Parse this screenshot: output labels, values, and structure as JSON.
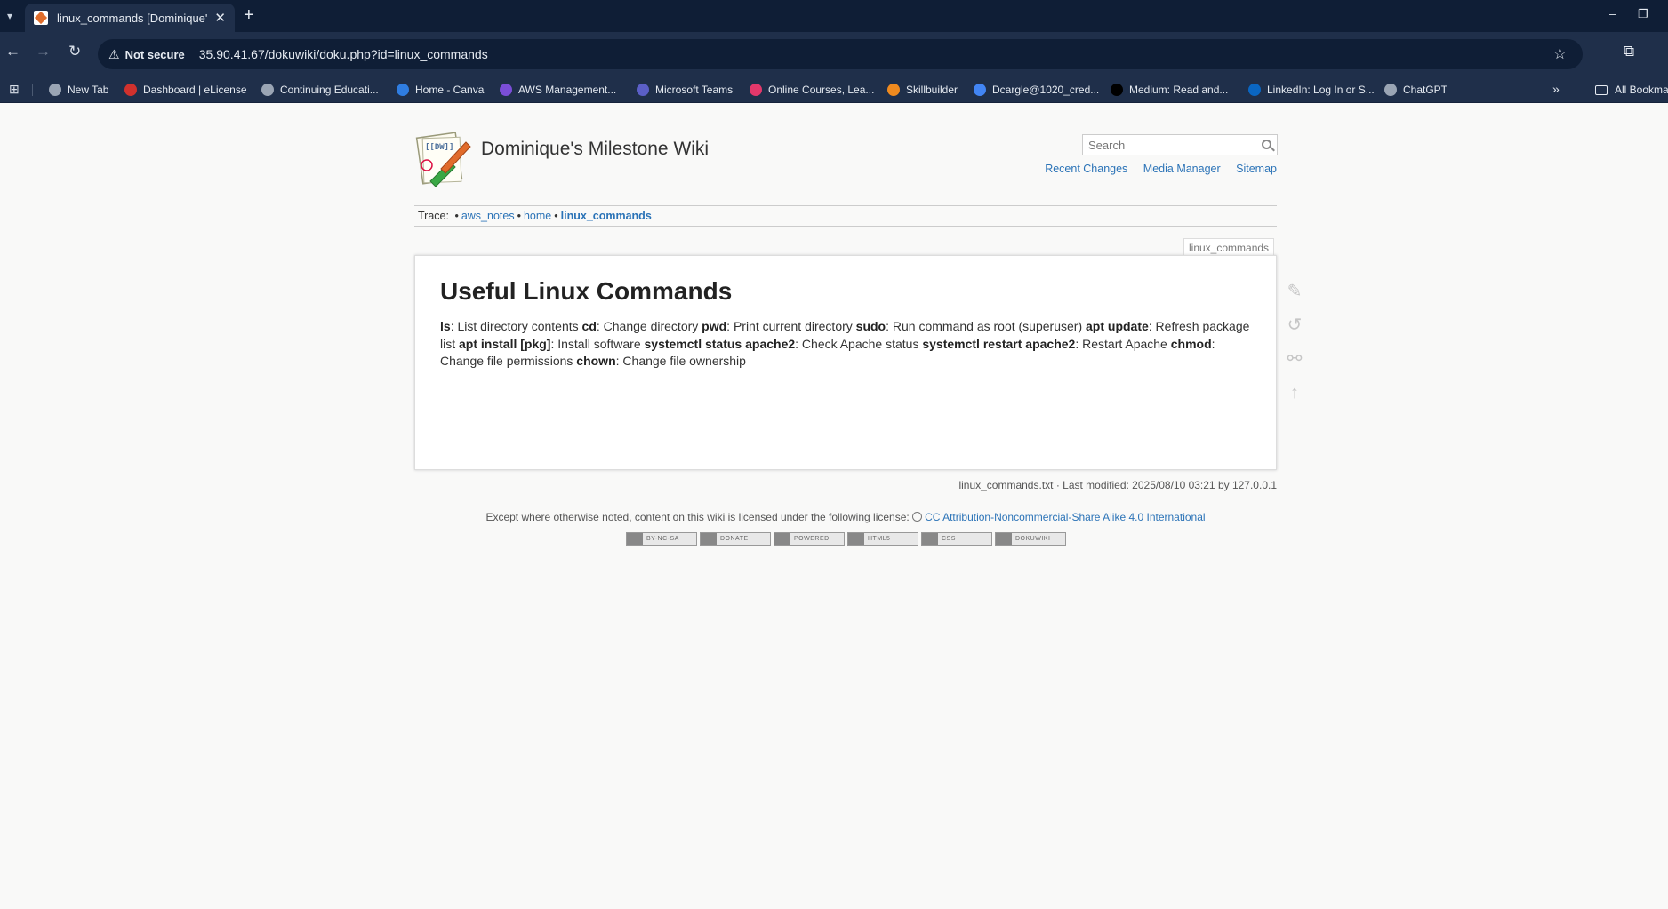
{
  "browser": {
    "tab": {
      "title": "linux_commands [Dominique's Milestone Wiki]",
      "close": "✕"
    },
    "new_tab": "+",
    "window": {
      "minimize": "–",
      "restore": "❐"
    },
    "nav": {
      "back": "←",
      "forward": "→",
      "reload": "↻"
    },
    "address": {
      "security": "Not secure",
      "url": "35.90.41.67/dokuwiki/doku.php?id=linux_commands"
    },
    "bookmarks": [
      {
        "label": "New Tab",
        "icon_color": "#9aa5b4"
      },
      {
        "label": "Dashboard | eLicense",
        "icon_color": "#d0312d"
      },
      {
        "label": "Continuing Educati...",
        "icon_color": "#9aa5b4"
      },
      {
        "label": "Home - Canva",
        "icon_color": "#2f7de1"
      },
      {
        "label": "AWS Management...",
        "icon_color": "#7b4ed8"
      },
      {
        "label": "Microsoft Teams",
        "icon_color": "#5b5fc7"
      },
      {
        "label": "Online Courses, Lea...",
        "icon_color": "#e3386b"
      },
      {
        "label": "Skillbuilder",
        "icon_color": "#ef8a1f"
      },
      {
        "label": "Dcargle@1020_cred...",
        "icon_color": "#4285f4"
      },
      {
        "label": "Medium: Read and...",
        "icon_color": "#000000"
      },
      {
        "label": "LinkedIn: Log In or S...",
        "icon_color": "#0a66c2"
      },
      {
        "label": "ChatGPT",
        "icon_color": "#9aa5b4"
      }
    ],
    "bookmarks_more": "»",
    "all_bookmarks": "All Bookmarks"
  },
  "wiki": {
    "title": "Dominique's Milestone Wiki",
    "search_placeholder": "Search",
    "tools": {
      "recent": "Recent Changes",
      "media": "Media Manager",
      "sitemap": "Sitemap"
    },
    "trace": {
      "label": "Trace:",
      "items": [
        "aws_notes",
        "home",
        "linux_commands"
      ]
    },
    "page_id": "linux_commands",
    "heading": "Useful Linux Commands",
    "commands": [
      {
        "cmd": "ls",
        "desc": ": List directory contents "
      },
      {
        "cmd": "cd",
        "desc": ": Change directory "
      },
      {
        "cmd": "pwd",
        "desc": ": Print current directory "
      },
      {
        "cmd": "sudo",
        "desc": ": Run command as root (superuser) "
      },
      {
        "cmd": "apt update",
        "desc": ": Refresh package list "
      },
      {
        "cmd": "apt install [pkg]",
        "desc": ": Install software "
      },
      {
        "cmd": "systemctl status apache2",
        "desc": ": Check Apache status "
      },
      {
        "cmd": "systemctl restart apache2",
        "desc": ": Restart Apache "
      },
      {
        "cmd": "chmod",
        "desc": ": Change file permissions "
      },
      {
        "cmd": "chown",
        "desc": ": Change file ownership"
      }
    ],
    "docinfo": "linux_commands.txt · Last modified: 2025/08/10 03:21 by 127.0.0.1",
    "license_text": "Except where otherwise noted, content on this wiki is licensed under the following license:",
    "license_link": "CC Attribution-Noncommercial-Share Alike 4.0 International",
    "badges": [
      "BY-NC-SA",
      "DONATE",
      "POWERED",
      "HTML5",
      "CSS",
      "DOKUWIKI"
    ],
    "logo_text": "[[DW]]"
  }
}
